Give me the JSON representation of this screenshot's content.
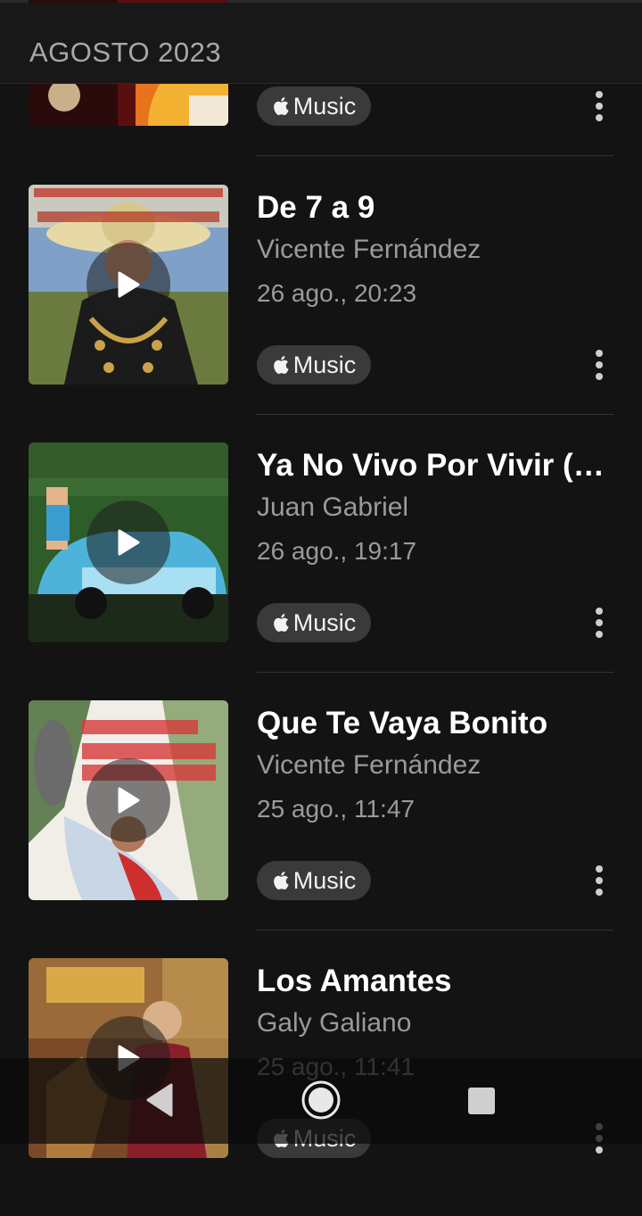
{
  "header": {
    "title": "AGOSTO 2023"
  },
  "badge_label": "Music",
  "items": [
    {
      "song": "",
      "artist": "",
      "date": ""
    },
    {
      "song": "De 7 a 9",
      "artist": "Vicente Fernández",
      "date": "26 ago., 20:23"
    },
    {
      "song": "Ya No Vivo Por Vivir (f…",
      "artist": "Juan Gabriel",
      "date": "26 ago., 19:17"
    },
    {
      "song": "Que Te Vaya Bonito",
      "artist": "Vicente Fernández",
      "date": "25 ago., 11:47"
    },
    {
      "song": "Los Amantes",
      "artist": "Galy Galiano",
      "date": "25 ago., 11:41"
    }
  ],
  "colors": {
    "background": "#131313",
    "badge": "#3a3a3a",
    "secondary_text": "#9a9a9a"
  },
  "icons": [
    "play-icon",
    "apple-logo-icon",
    "more-vertical-icon",
    "nav-back-icon",
    "nav-home-icon",
    "nav-recents-icon"
  ]
}
